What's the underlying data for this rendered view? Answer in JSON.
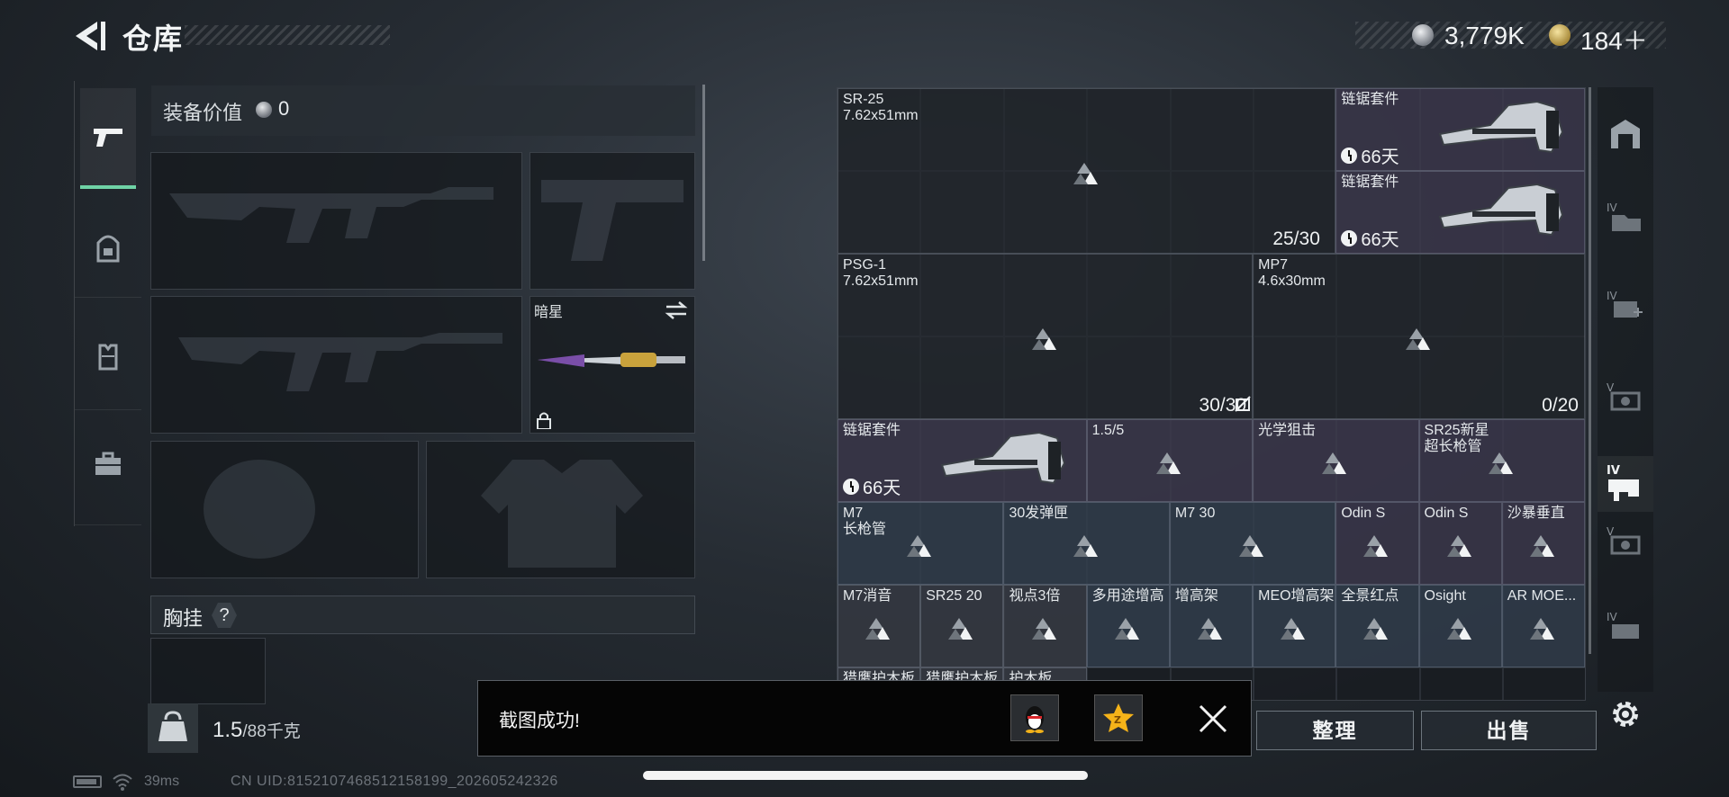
{
  "topbar": {
    "title": "仓库",
    "currency_silver": "3,779K",
    "currency_gold": "184＋"
  },
  "loadout": {
    "equip_value_label": "装备价值",
    "equip_value": "0",
    "melee_name": "暗星",
    "chest_rig_label": "胸挂",
    "chest_rig_help": "?",
    "weight_current": "1.5",
    "weight_max": "/88千克"
  },
  "storage": {
    "items": [
      {
        "name": "SR-25\n7.62x51mm",
        "count": ""
      },
      {
        "name": "链锯套件",
        "timer": "66天"
      },
      {
        "name": "链锯套件",
        "timer": "66天"
      },
      {
        "count": "25/30"
      },
      {
        "name": "PSG-1\n7.62x51mm",
        "count": "30/30"
      },
      {
        "name": "MP7\n4.6x30mm",
        "count": "0/20"
      },
      {
        "name": "链锯套件",
        "timer": "66天"
      },
      {
        "name": "1.5/5"
      },
      {
        "name": "光学狙击"
      },
      {
        "name": "SR25新星\n超长枪管"
      },
      {
        "name": "M7\n长枪管"
      },
      {
        "name": "30发弹匣"
      },
      {
        "name": "M7 30"
      },
      {
        "name": "Odin S"
      },
      {
        "name": "Odin S"
      },
      {
        "name": "沙暴垂直"
      },
      {
        "name": "M7消音"
      },
      {
        "name": "SR25 20"
      },
      {
        "name": "视点3倍"
      },
      {
        "name": "多用途增高"
      },
      {
        "name": "增高架"
      },
      {
        "name": "MEO增高架"
      },
      {
        "name": "全景红点"
      },
      {
        "name": "Osight"
      },
      {
        "name": "AR MOE..."
      },
      {
        "name": "猎鹰护木板"
      },
      {
        "name": "猎鹰护木板"
      },
      {
        "name": "护木板"
      }
    ]
  },
  "buttons": {
    "organize": "整理",
    "sell": "出售"
  },
  "toast": {
    "message": "截图成功!"
  },
  "status": {
    "ping": "39ms",
    "uid": "CN UID:8152107468512158199_202605242326"
  },
  "icons": {
    "back": "back-arrow-icon",
    "weapons_tab": "pistol-icon",
    "backpack_tab": "backpack-icon",
    "vest_tab": "vest-icon",
    "case_tab": "briefcase-icon",
    "settings": "gear-icon"
  },
  "colors": {
    "accent_green": "#6fd3a6",
    "rarity_purple": "#3e3a4e",
    "rarity_blue": "#323e4e"
  }
}
